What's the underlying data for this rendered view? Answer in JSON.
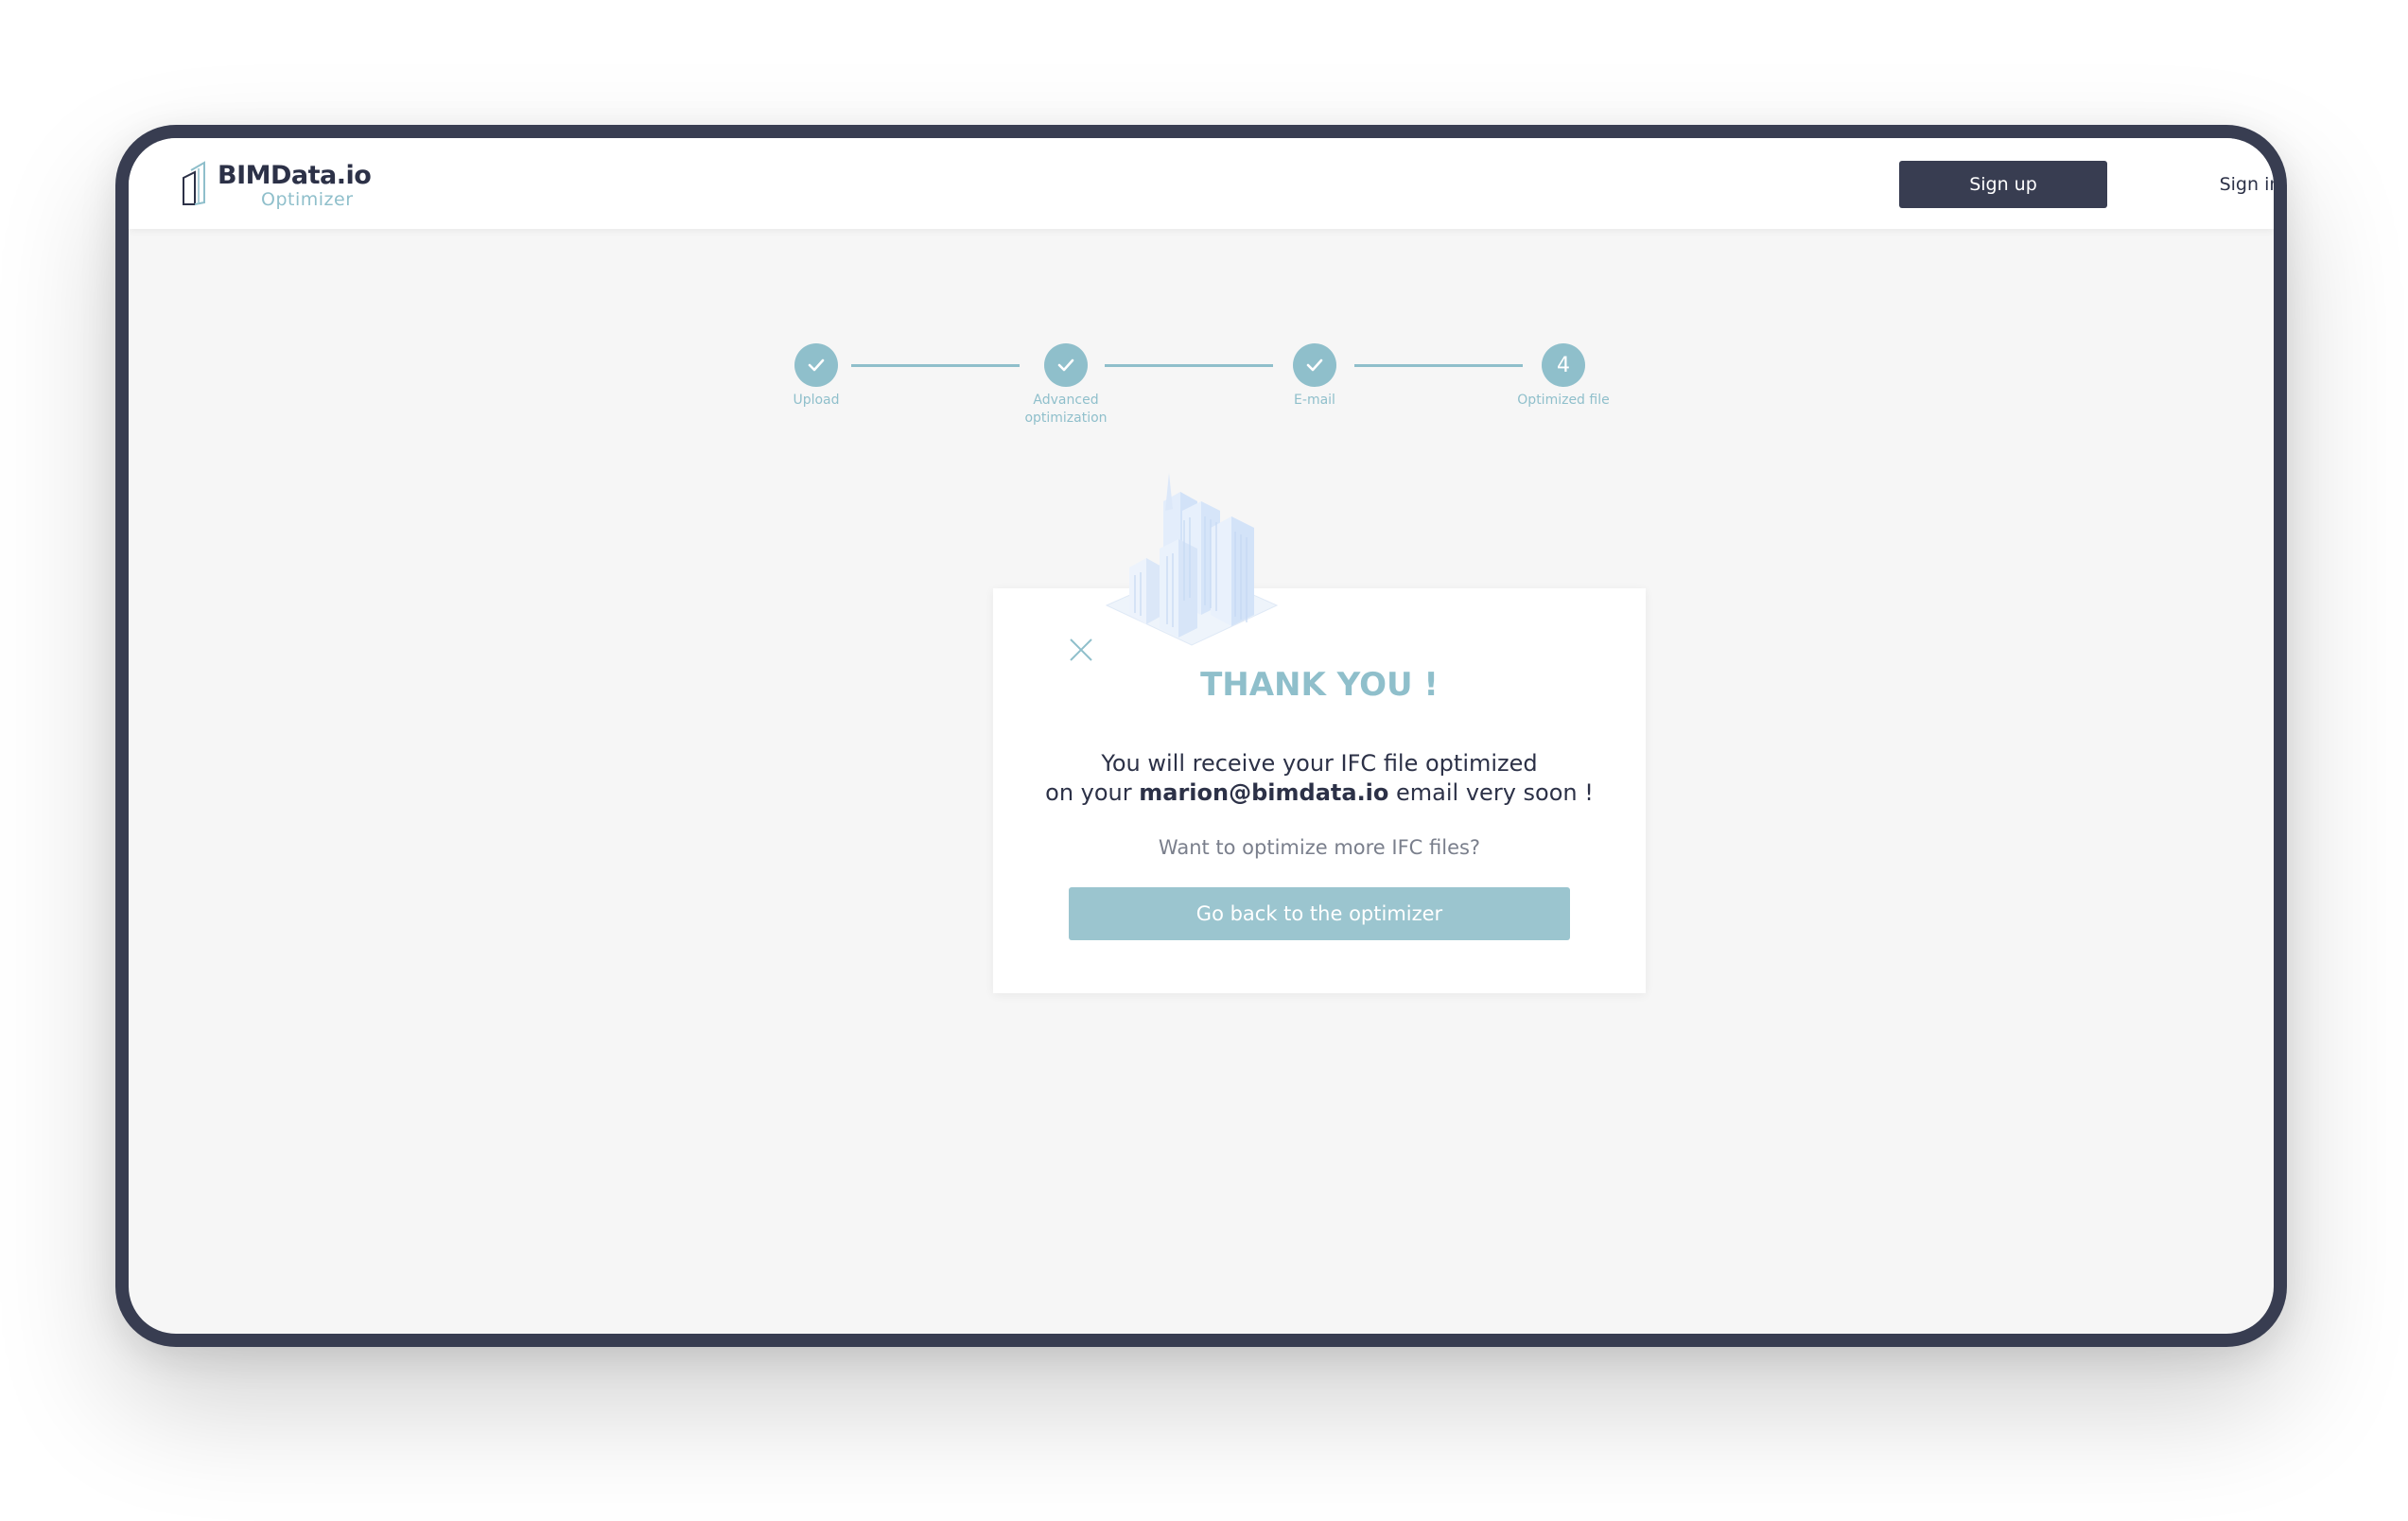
{
  "header": {
    "logo_title": "BIMData.io",
    "logo_subtitle": "Optimizer",
    "signup_label": "Sign up",
    "signin_label": "Sign in"
  },
  "stepper": {
    "steps": [
      {
        "label": "Upload",
        "state": "done",
        "icon": "check-icon"
      },
      {
        "label": "Advanced optimization",
        "state": "done",
        "icon": "check-icon"
      },
      {
        "label": "E-mail",
        "state": "done",
        "icon": "check-icon"
      },
      {
        "label": "Optimized file",
        "state": "current",
        "number": "4"
      }
    ]
  },
  "modal": {
    "title": "THANK YOU !",
    "message_line1": "You will receive your IFC file optimized",
    "message_line2_prefix": "on your ",
    "email": "marion@bimdata.io",
    "message_line2_suffix": " email very soon !",
    "question": "Want to optimize more IFC files?",
    "button_label": "Go back to the optimizer",
    "illustration": "buildings-illustration",
    "close_icon": "close-icon"
  },
  "colors": {
    "primary_dark": "#383d51",
    "accent": "#8fbfcb",
    "background": "#f6f6f6",
    "text": "#2c3147"
  }
}
